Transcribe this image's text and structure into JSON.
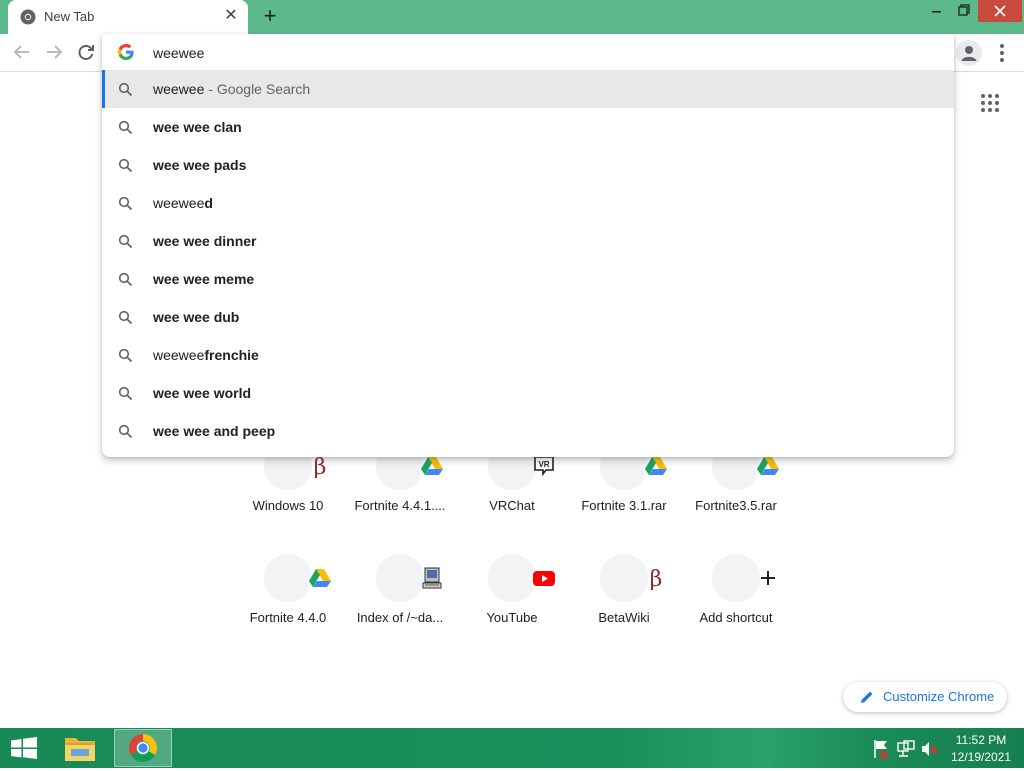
{
  "browser": {
    "tab": {
      "title": "New Tab",
      "close_glyph": "✕"
    },
    "new_tab_glyph": "+",
    "window_controls": [
      "minimize-icon",
      "restore-icon",
      "close-icon"
    ]
  },
  "omnibox": {
    "value": "weewee",
    "suggestions": [
      {
        "parts": [
          {
            "text": "weewee",
            "bold": false
          },
          {
            "text": " - Google Search",
            "dim": true
          }
        ],
        "selected": true
      },
      {
        "parts": [
          {
            "text": "wee wee clan",
            "bold": true
          }
        ]
      },
      {
        "parts": [
          {
            "text": "wee wee pads",
            "bold": true
          }
        ]
      },
      {
        "parts": [
          {
            "text": "weewee",
            "bold": false
          },
          {
            "text": "d",
            "bold": true
          }
        ]
      },
      {
        "parts": [
          {
            "text": "wee wee dinner",
            "bold": true
          }
        ]
      },
      {
        "parts": [
          {
            "text": "wee wee meme",
            "bold": true
          }
        ]
      },
      {
        "parts": [
          {
            "text": "wee wee dub",
            "bold": true
          }
        ]
      },
      {
        "parts": [
          {
            "text": "weewee",
            "bold": false
          },
          {
            "text": "frenchie",
            "bold": true
          }
        ]
      },
      {
        "parts": [
          {
            "text": "wee wee world",
            "bold": true
          }
        ]
      },
      {
        "parts": [
          {
            "text": "wee wee and peep",
            "bold": true
          }
        ]
      }
    ]
  },
  "shortcuts": [
    {
      "label": "Windows 10",
      "icon": "betawiki-icon"
    },
    {
      "label": "Fortnite 4.4.1....",
      "icon": "google-drive-icon"
    },
    {
      "label": "VRChat",
      "icon": "vrchat-icon"
    },
    {
      "label": "Fortnite 3.1.rar",
      "icon": "google-drive-icon"
    },
    {
      "label": "Fortnite3.5.rar",
      "icon": "google-drive-icon"
    },
    {
      "label": "Fortnite 4.4.0",
      "icon": "google-drive-icon"
    },
    {
      "label": "Index of /~da...",
      "icon": "computer-icon"
    },
    {
      "label": "YouTube",
      "icon": "youtube-icon"
    },
    {
      "label": "BetaWiki",
      "icon": "betawiki-icon"
    },
    {
      "label": "Add shortcut",
      "icon": "plus-icon"
    }
  ],
  "customize": {
    "label": "Customize Chrome"
  },
  "taskbar": {
    "time": "11:52 PM",
    "date": "12/19/2021"
  },
  "colors": {
    "accent": "#1a73e8",
    "tabstrip": "#5cb98a",
    "taskbar": "#188a55"
  }
}
